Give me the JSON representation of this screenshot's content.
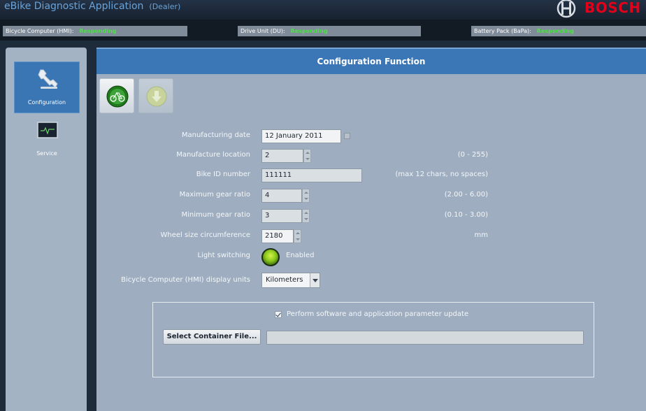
{
  "app": {
    "title": "eBike Diagnostic Application",
    "role": "(Dealer)",
    "brand": "BOSCH"
  },
  "status": {
    "items": [
      {
        "label": "Bicycle Computer (HMI):",
        "value": "Responding"
      },
      {
        "label": "Drive Unit (DU):",
        "value": "Responding"
      },
      {
        "label": "Battery Pack (BaPa):",
        "value": "Responding"
      }
    ]
  },
  "sidebar": {
    "items": [
      {
        "label": "Configuration",
        "icon": "wrench-icon",
        "active": true
      },
      {
        "label": "Service",
        "icon": "monitor-icon",
        "active": false
      }
    ]
  },
  "panel": {
    "title": "Configuration Function",
    "toolbar": [
      {
        "icon": "bike-gear-icon",
        "enabled": true
      },
      {
        "icon": "download-icon",
        "enabled": false
      }
    ]
  },
  "form": {
    "manufacturing_date": {
      "label": "Manufacturing date",
      "value": "12 January 2011"
    },
    "manufacture_location": {
      "label": "Manufacture location",
      "value": "2",
      "hint": "(0 - 255)"
    },
    "bike_id": {
      "label": "Bike ID number",
      "value": "111111",
      "hint": "(max 12 chars, no spaces)"
    },
    "max_gear_ratio": {
      "label": "Maximum gear ratio",
      "value": "4",
      "hint": "(2.00 - 6.00)"
    },
    "min_gear_ratio": {
      "label": "Minimum gear ratio",
      "value": "3",
      "hint": "(0.10 - 3.00)"
    },
    "wheel_size": {
      "label": "Wheel size circumference",
      "value": "2180",
      "hint": "mm"
    },
    "light_switching": {
      "label": "Light switching",
      "status": "Enabled"
    },
    "display_units": {
      "label": "Bicycle Computer (HMI) display units",
      "value": "Kilometers"
    }
  },
  "update": {
    "checkbox_label": "Perform software and application parameter update",
    "checked": true,
    "button_label": "Select Container File...",
    "file_path": ""
  },
  "colors": {
    "accent": "#3b77b7",
    "status_ok": "#4ee047",
    "brand_red": "#e2001a",
    "panel_bg": "#9eaec0"
  }
}
